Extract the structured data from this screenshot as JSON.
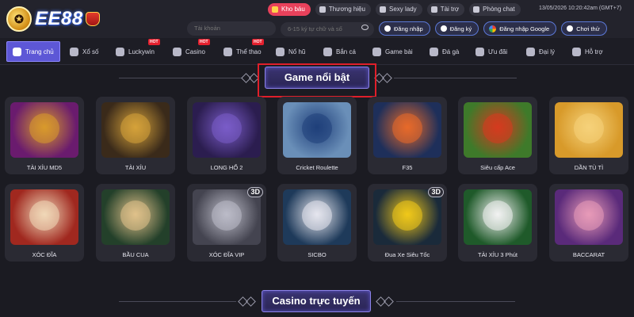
{
  "brand": {
    "logo_text": "EE88"
  },
  "topnav": {
    "items": [
      {
        "label": "Kho báu",
        "icon": "gift-icon",
        "active": true
      },
      {
        "label": "Thương hiệu",
        "icon": "brand-icon",
        "active": false
      },
      {
        "label": "Sexy lady",
        "icon": "play-icon",
        "active": false
      },
      {
        "label": "Tài trợ",
        "icon": "sponsor-icon",
        "active": false
      },
      {
        "label": "Phòng chat",
        "icon": "chat-icon",
        "active": false
      }
    ],
    "datetime": "13/05/2026 10:20:42am",
    "timezone": "(GMT+7)"
  },
  "login": {
    "username_placeholder": "Tài khoản",
    "password_placeholder": "6-15 ký tự chữ và số",
    "login_label": "Đăng nhập",
    "register_label": "Đăng ký",
    "google_label": "Đăng nhập Google",
    "trial_label": "Chơi thử"
  },
  "mainnav": {
    "items": [
      {
        "label": "Trang chủ",
        "icon": "home-icon",
        "active": true,
        "hot": false
      },
      {
        "label": "Xổ số",
        "icon": "lottery-icon",
        "active": false,
        "hot": false
      },
      {
        "label": "Luckywin",
        "icon": "luckywin-icon",
        "active": false,
        "hot": true
      },
      {
        "label": "Casino",
        "icon": "casino-icon",
        "active": false,
        "hot": true
      },
      {
        "label": "Thể thao",
        "icon": "sports-icon",
        "active": false,
        "hot": true
      },
      {
        "label": "Nổ hũ",
        "icon": "slot-icon",
        "active": false,
        "hot": false
      },
      {
        "label": "Bắn cá",
        "icon": "fish-icon",
        "active": false,
        "hot": false
      },
      {
        "label": "Game bài",
        "icon": "cards-icon",
        "active": false,
        "hot": false
      },
      {
        "label": "Đá gà",
        "icon": "rooster-icon",
        "active": false,
        "hot": false
      },
      {
        "label": "Ưu đãi",
        "icon": "promo-icon",
        "active": false,
        "hot": false
      },
      {
        "label": "Đại lý",
        "icon": "agent-icon",
        "active": false,
        "hot": false
      },
      {
        "label": "Hỗ trợ",
        "icon": "support-icon",
        "active": false,
        "hot": false
      }
    ],
    "hot_label": "HOT"
  },
  "featured": {
    "title": "Game nổi bật",
    "games": [
      {
        "name": "TÀI XỈU MD5",
        "colors": [
          "#6a1b6e",
          "#d99a2b"
        ]
      },
      {
        "name": "TÀI XỈU",
        "colors": [
          "#3a2a1a",
          "#d6a23a"
        ]
      },
      {
        "name": "LONG HỔ 2",
        "colors": [
          "#2b1d4f",
          "#7a5cc9"
        ]
      },
      {
        "name": "Cricket Roulette",
        "colors": [
          "#6a8fb8",
          "#1f3f7a"
        ]
      },
      {
        "name": "F35",
        "colors": [
          "#1e2f5a",
          "#e86a2a"
        ]
      },
      {
        "name": "Siêu cấp Ace",
        "colors": [
          "#3e7a2a",
          "#d63a1f"
        ]
      },
      {
        "name": "DẦN TÙ TÌ",
        "colors": [
          "#d89a2a",
          "#f5d27a"
        ]
      },
      {
        "name": "XÓC ĐĨA",
        "colors": [
          "#a0281f",
          "#f0d8b8"
        ]
      },
      {
        "name": "BẦU CUA",
        "colors": [
          "#23402a",
          "#e0c18a"
        ]
      },
      {
        "name": "XÓC ĐĨA VIP",
        "colors": [
          "#444450",
          "#bcbcc8"
        ],
        "badge": "3D"
      },
      {
        "name": "SICBO",
        "colors": [
          "#1e3a5a",
          "#e6e6ee"
        ]
      },
      {
        "name": "Đua Xe Siêu Tốc",
        "colors": [
          "#1a2a3a",
          "#f0c81a"
        ],
        "badge": "3D"
      },
      {
        "name": "TÀI XỈU 3 Phút",
        "colors": [
          "#1f5a2a",
          "#f2f2f2"
        ]
      },
      {
        "name": "BACCARAT",
        "colors": [
          "#5a2a7a",
          "#e89ab8"
        ]
      }
    ]
  },
  "casino": {
    "title": "Casino trực tuyến"
  }
}
